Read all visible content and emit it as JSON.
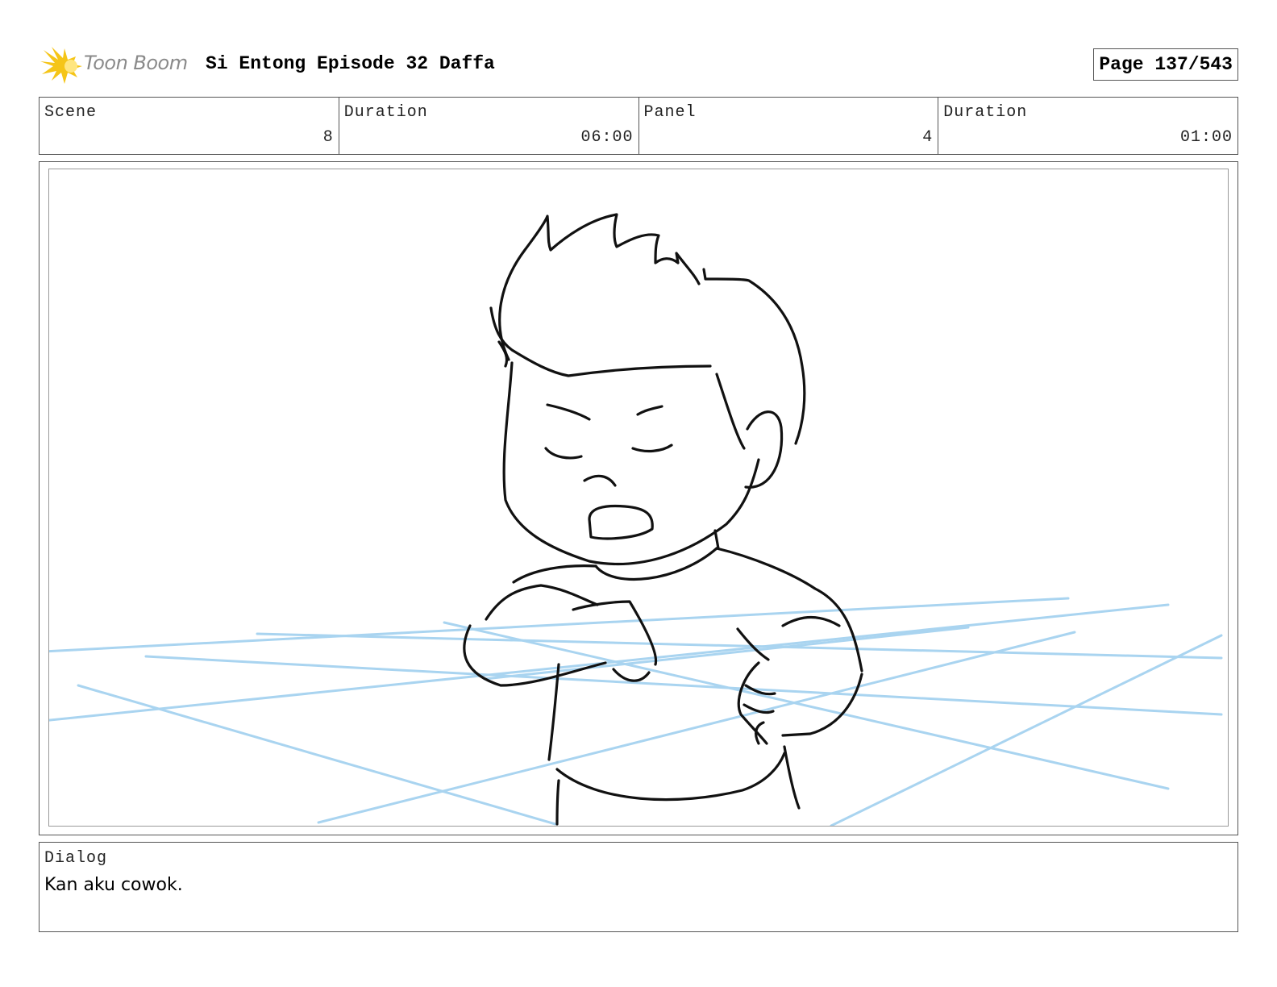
{
  "header": {
    "logo_text": "Toon Boom",
    "title": "Si Entong Episode 32 Daffa",
    "page_label": "Page 137/543"
  },
  "info": {
    "scene_label": "Scene",
    "scene_value": "8",
    "scene_duration_label": "Duration",
    "scene_duration_value": "06:00",
    "panel_label": "Panel",
    "panel_value": "4",
    "panel_duration_label": "Duration",
    "panel_duration_value": "01:00"
  },
  "dialog": {
    "label": "Dialog",
    "text": "Kan aku cowok."
  },
  "colors": {
    "logo_accent": "#f5c518",
    "floor_lines": "#a9d4f0",
    "sketch": "#111111"
  }
}
